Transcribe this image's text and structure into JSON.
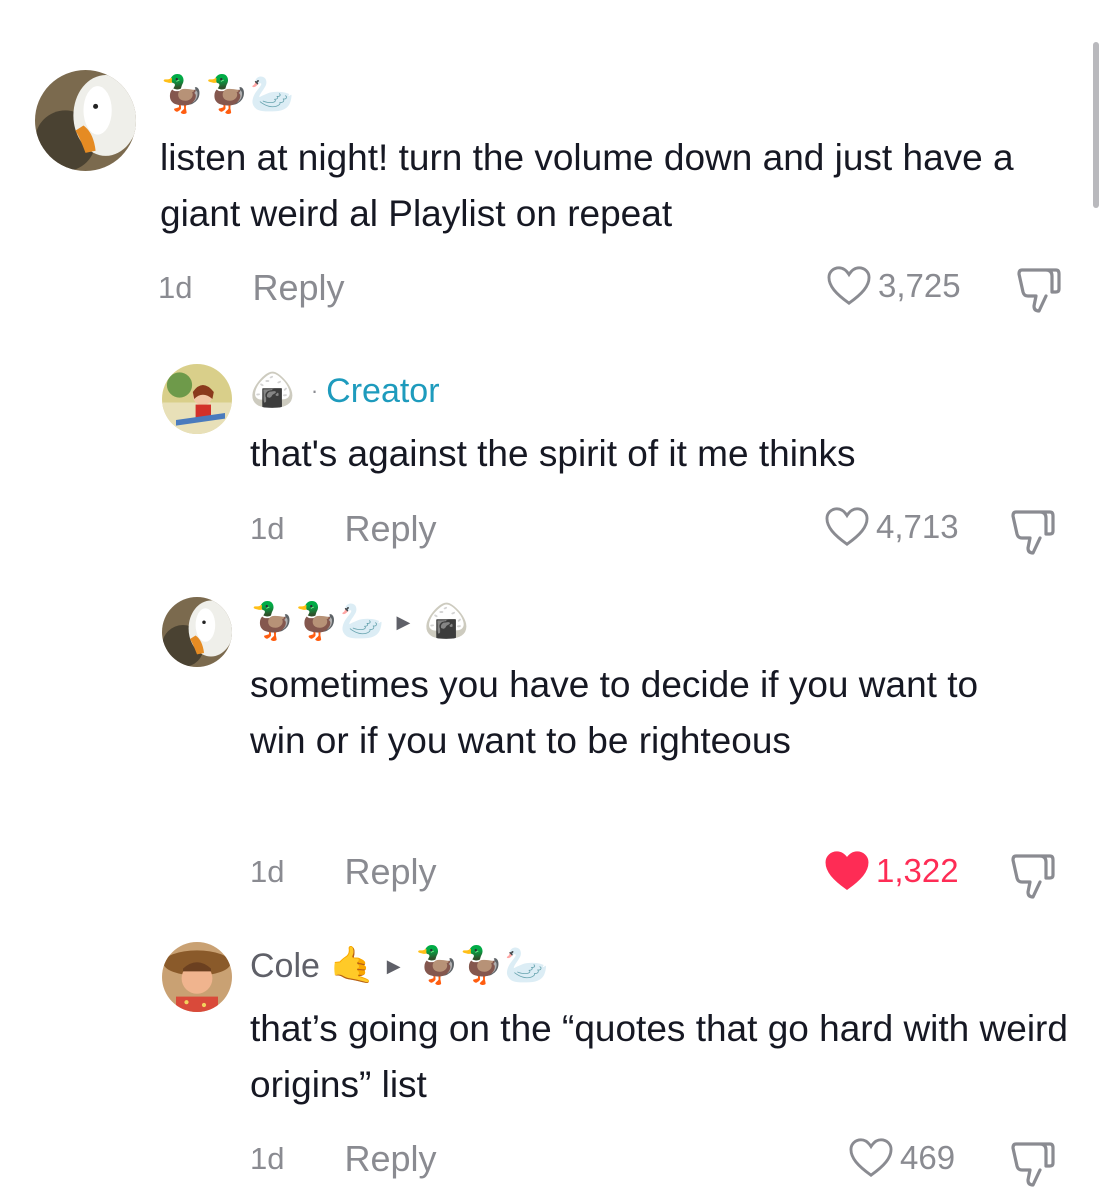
{
  "comments": [
    {
      "name": "🦆🦆🦢",
      "text": "listen at night! turn the volume down and just have a giant weird al Playlist on repeat",
      "time": "1d",
      "reply_label": "Reply",
      "likes": "3,725",
      "liked": false
    },
    {
      "name": "🍙",
      "creator_label": "Creator",
      "separator": "·",
      "text": "that's against the spirit of it me thinks",
      "time": "1d",
      "reply_label": "Reply",
      "likes": "4,713",
      "liked": false
    },
    {
      "name": "🦆🦆🦢",
      "reply_to_arrow": "▶",
      "reply_to": "🍙",
      "text": "sometimes you have to decide if you want to win or if you want to be righteous",
      "time": "1d",
      "reply_label": "Reply",
      "likes": "1,322",
      "liked": true
    },
    {
      "name": "Cole",
      "name_emoji": "🤙",
      "reply_to_arrow": "▶",
      "reply_to": "🦆🦆🦢",
      "text": "that’s going on the “quotes that go hard with weird origins” list",
      "time": "1d",
      "reply_label": "Reply",
      "likes": "469",
      "liked": false
    }
  ],
  "colors": {
    "accent_like": "#fe2c55",
    "creator_label": "#1e9bbd",
    "meta_gray": "#8a8b91"
  },
  "icons": {
    "like": "heart-outline-icon",
    "liked": "heart-filled-icon",
    "dislike": "thumbs-down-icon"
  }
}
